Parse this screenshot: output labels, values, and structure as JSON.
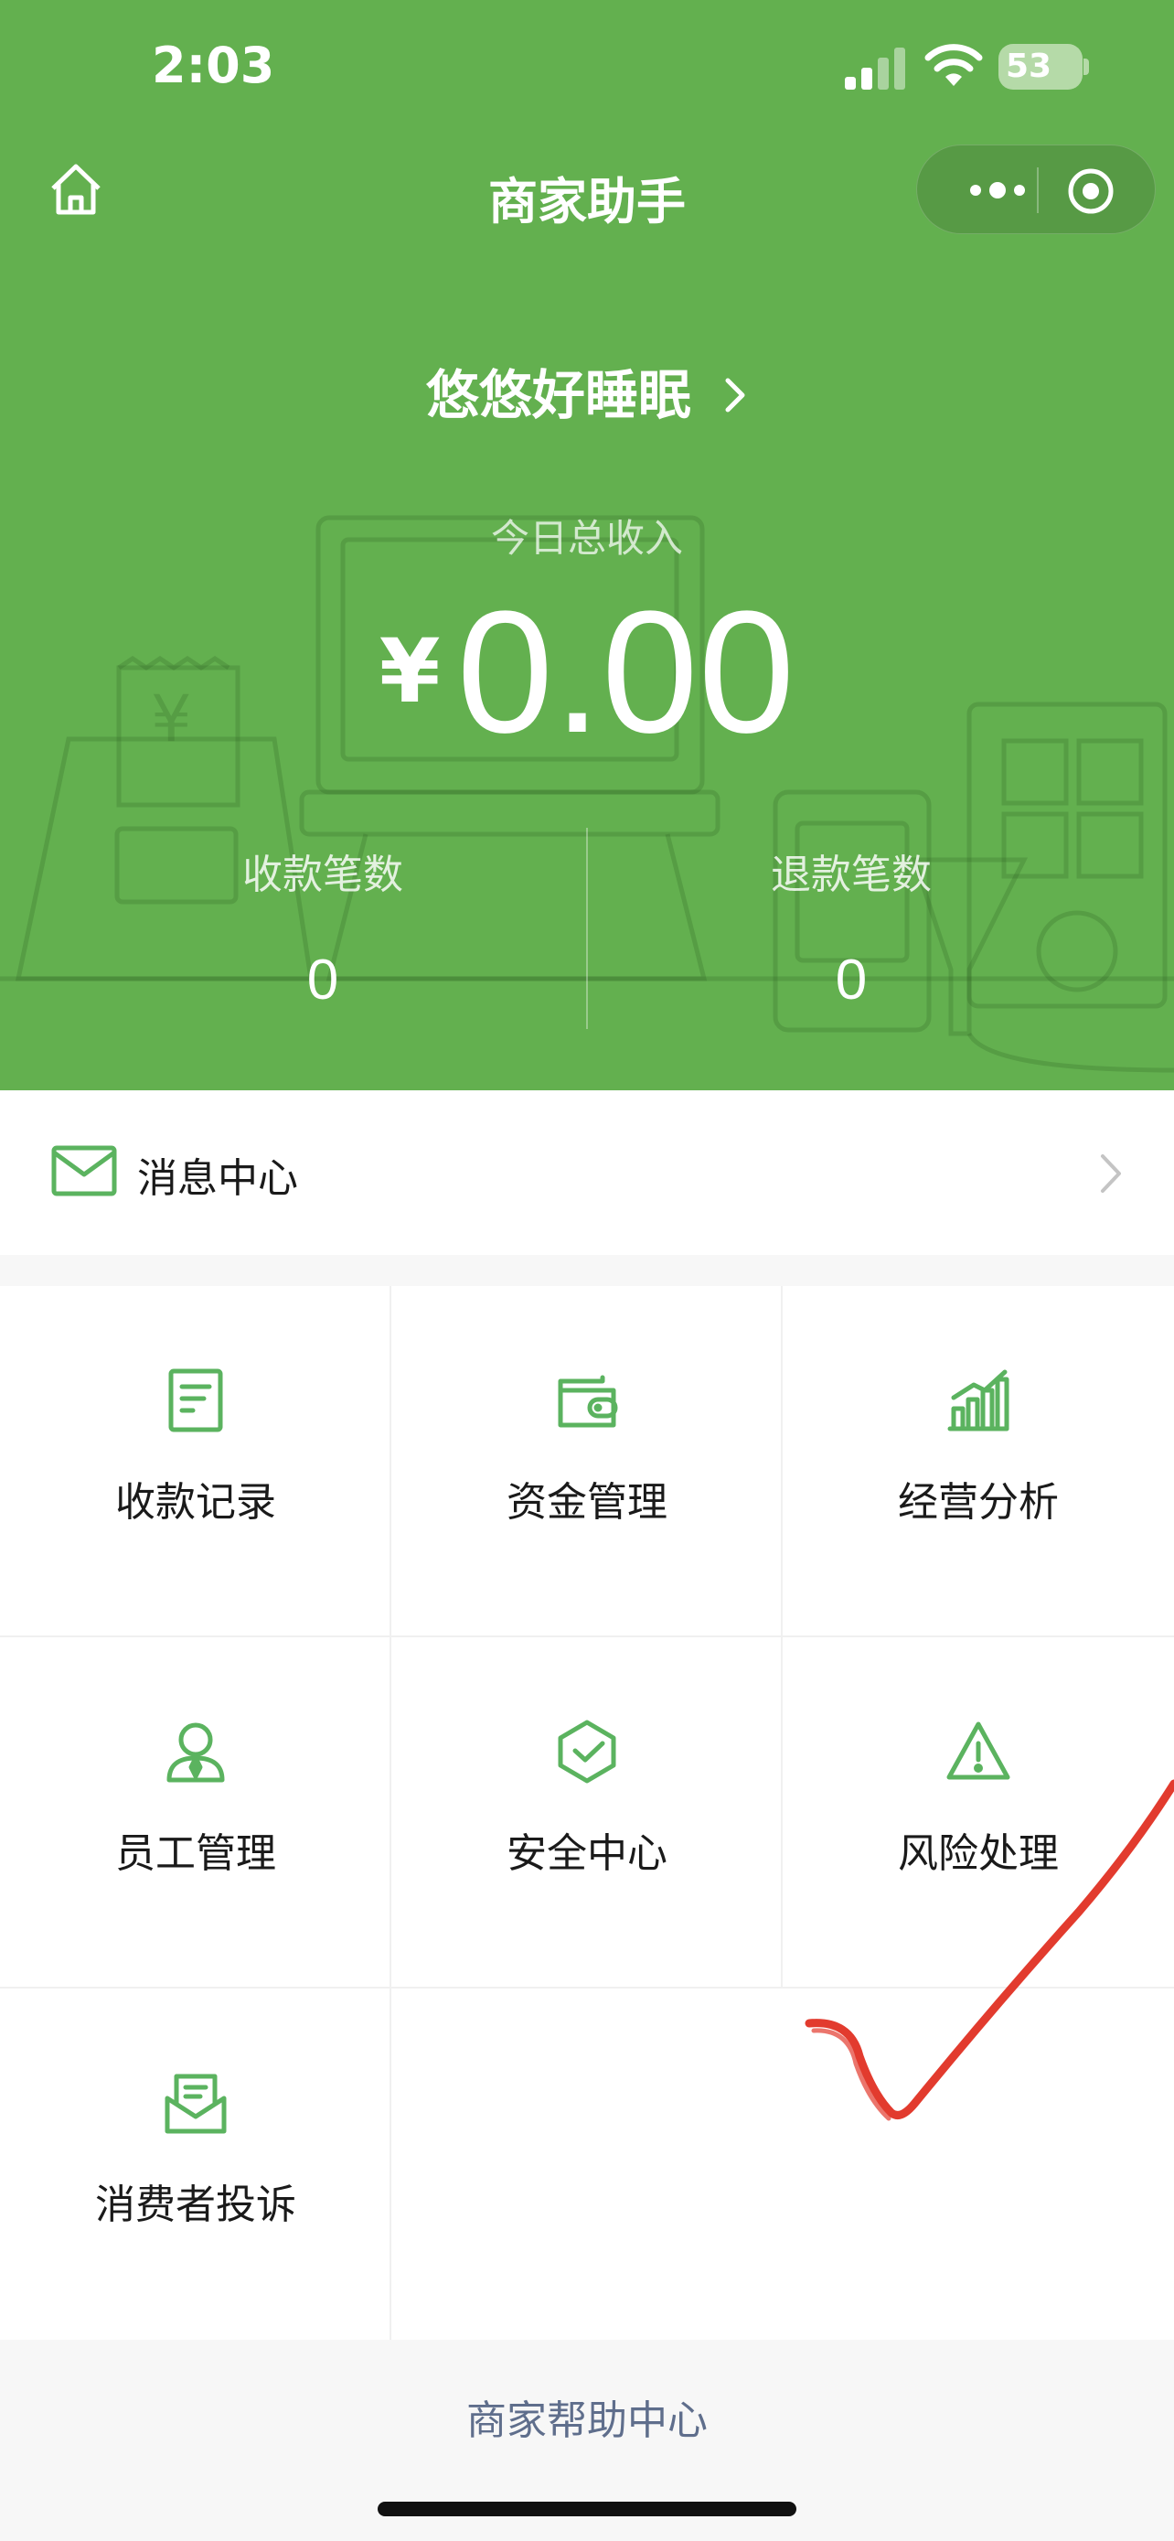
{
  "status_bar": {
    "time": "2:03",
    "battery": "53"
  },
  "nav": {
    "title": "商家助手"
  },
  "merchant": {
    "name": "悠悠好睡眠"
  },
  "income": {
    "label": "今日总收入",
    "currency": "¥",
    "amount": "0.00"
  },
  "stats": [
    {
      "label": "收款笔数",
      "value": "0"
    },
    {
      "label": "退款笔数",
      "value": "0"
    }
  ],
  "message_center": {
    "label": "消息中心"
  },
  "grid_items": [
    {
      "label": "收款记录",
      "icon": "receipt-icon"
    },
    {
      "label": "资金管理",
      "icon": "wallet-icon"
    },
    {
      "label": "经营分析",
      "icon": "bar-chart-icon"
    },
    {
      "label": "员工管理",
      "icon": "staff-icon"
    },
    {
      "label": "安全中心",
      "icon": "shield-icon"
    },
    {
      "label": "风险处理",
      "icon": "warning-icon"
    },
    {
      "label": "消费者投诉",
      "icon": "complaint-icon"
    }
  ],
  "footer": {
    "help_link": "商家帮助中心"
  },
  "colors": {
    "brand_green": "#63b04f",
    "icon_green": "#5bb35f",
    "annotation_red": "#e23b2e"
  }
}
